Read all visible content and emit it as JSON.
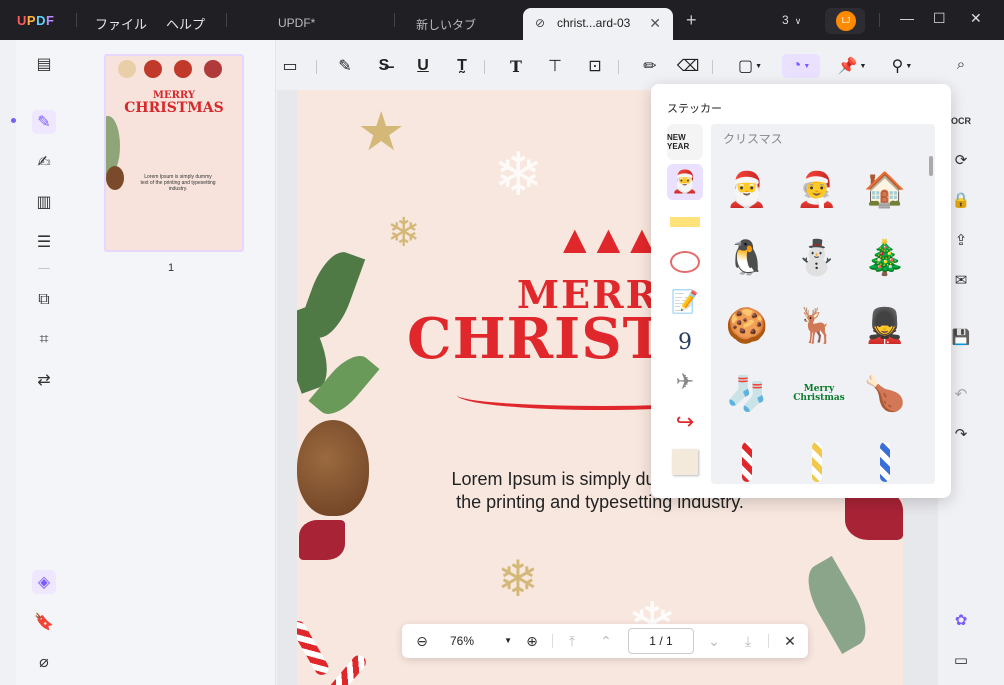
{
  "app": {
    "logo": "UPDF",
    "menus": [
      "ファイル",
      "ヘルプ"
    ]
  },
  "tabs": [
    {
      "label": "UPDF*"
    },
    {
      "label": "新しいタブ"
    },
    {
      "label": "christ...ard-03"
    }
  ],
  "titlebar": {
    "count": "3",
    "avatar_initials": "LJ"
  },
  "thumbnails": {
    "page_number": "1"
  },
  "document": {
    "merry": "MERRY",
    "christmas": "CHRISTMAS",
    "lorem": "Lorem Ipsum is simply dummy text of the printing and typesetting industry."
  },
  "thumbnail_text": {
    "merry": "MERRY",
    "christmas": "CHRISTMAS",
    "lorem": "Lorem Ipsum is simply dummy text of the printing and typesetting industry."
  },
  "sticker_panel": {
    "title": "ステッカー",
    "category_title": "クリスマス",
    "categories": [
      {
        "name": "new-year",
        "label": "NEW YEAR"
      },
      {
        "name": "christmas"
      },
      {
        "name": "tape"
      },
      {
        "name": "circle"
      },
      {
        "name": "note"
      },
      {
        "name": "number"
      },
      {
        "name": "paper-plane"
      },
      {
        "name": "arrow"
      },
      {
        "name": "sticky-note"
      }
    ],
    "stickers_text": {
      "merry_christmas": "Merry Christmas"
    }
  },
  "pagebar": {
    "zoom": "76%",
    "current_page": "1",
    "page_sep": "/",
    "total_pages": "1"
  },
  "colors": {
    "accent": "#7a5cff",
    "titlebar": "#1f1f24",
    "christmas_red": "#e0272b",
    "page_bg": "#f8e7df"
  }
}
